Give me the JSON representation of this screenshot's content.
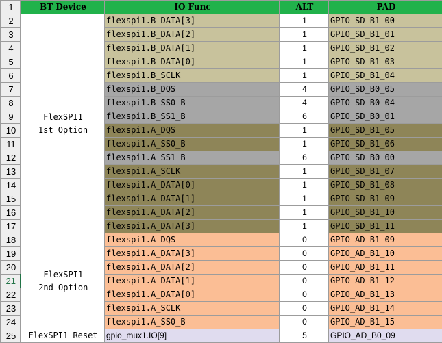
{
  "header": {
    "row": "1",
    "device": "BT Device",
    "func": "IO Func",
    "alt": "ALT",
    "pad": "PAD"
  },
  "groups": [
    {
      "label1": "FlexSPI1",
      "label2": "1st Option"
    },
    {
      "label1": "FlexSPI1",
      "label2": "2nd Option"
    },
    {
      "label1": "FlexSPI1 Reset",
      "label2": ""
    }
  ],
  "rows": [
    {
      "n": "2",
      "func": "flexspi1.B_DATA[3]",
      "alt": "1",
      "pad": "GPIO_SD_B1_00",
      "color": "tan"
    },
    {
      "n": "3",
      "func": "flexspi1.B_DATA[2]",
      "alt": "1",
      "pad": "GPIO_SD_B1_01",
      "color": "tan"
    },
    {
      "n": "4",
      "func": "flexspi1.B_DATA[1]",
      "alt": "1",
      "pad": "GPIO_SD_B1_02",
      "color": "tan"
    },
    {
      "n": "5",
      "func": "flexspi1.B_DATA[0]",
      "alt": "1",
      "pad": "GPIO_SD_B1_03",
      "color": "tan"
    },
    {
      "n": "6",
      "func": "flexspi1.B_SCLK",
      "alt": "1",
      "pad": "GPIO_SD_B1_04",
      "color": "tan"
    },
    {
      "n": "7",
      "func": "flexspi1.B_DQS",
      "alt": "4",
      "pad": "GPIO_SD_B0_05",
      "color": "gray"
    },
    {
      "n": "8",
      "func": "flexspi1.B_SS0_B",
      "alt": "4",
      "pad": "GPIO_SD_B0_04",
      "color": "gray"
    },
    {
      "n": "9",
      "func": "flexspi1.B_SS1_B",
      "alt": "6",
      "pad": "GPIO_SD_B0_01",
      "color": "gray"
    },
    {
      "n": "10",
      "func": "flexspi1.A_DQS",
      "alt": "1",
      "pad": "GPIO_SD_B1_05",
      "color": "olive"
    },
    {
      "n": "11",
      "func": "flexspi1.A_SS0_B",
      "alt": "1",
      "pad": "GPIO_SD_B1_06",
      "color": "olive"
    },
    {
      "n": "12",
      "func": "flexspi1.A_SS1_B",
      "alt": "6",
      "pad": "GPIO_SD_B0_00",
      "color": "gray"
    },
    {
      "n": "13",
      "func": "flexspi1.A_SCLK",
      "alt": "1",
      "pad": "GPIO_SD_B1_07",
      "color": "olive"
    },
    {
      "n": "14",
      "func": "flexspi1.A_DATA[0]",
      "alt": "1",
      "pad": "GPIO_SD_B1_08",
      "color": "olive"
    },
    {
      "n": "15",
      "func": "flexspi1.A_DATA[1]",
      "alt": "1",
      "pad": "GPIO_SD_B1_09",
      "color": "olive"
    },
    {
      "n": "16",
      "func": "flexspi1.A_DATA[2]",
      "alt": "1",
      "pad": "GPIO_SD_B1_10",
      "color": "olive"
    },
    {
      "n": "17",
      "func": "flexspi1.A_DATA[3]",
      "alt": "1",
      "pad": "GPIO_SD_B1_11",
      "color": "olive"
    },
    {
      "n": "18",
      "func": "flexspi1.A_DQS",
      "alt": "0",
      "pad": "GPIO_AD_B1_09",
      "color": "peach"
    },
    {
      "n": "19",
      "func": "flexspi1.A_DATA[3]",
      "alt": "0",
      "pad": "GPIO_AD_B1_10",
      "color": "peach"
    },
    {
      "n": "20",
      "func": "flexspi1.A_DATA[2]",
      "alt": "0",
      "pad": "GPIO_AD_B1_11",
      "color": "peach"
    },
    {
      "n": "21",
      "func": "flexspi1.A_DATA[1]",
      "alt": "0",
      "pad": "GPIO_AD_B1_12",
      "color": "peach"
    },
    {
      "n": "22",
      "func": "flexspi1.A_DATA[0]",
      "alt": "0",
      "pad": "GPIO_AD_B1_13",
      "color": "peach"
    },
    {
      "n": "23",
      "func": "flexspi1.A_SCLK",
      "alt": "0",
      "pad": "GPIO_AD_B1_14",
      "color": "peach"
    },
    {
      "n": "24",
      "func": "flexspi1.A_SS0_B",
      "alt": "0",
      "pad": "GPIO_AD_B1_15",
      "color": "peach"
    },
    {
      "n": "25",
      "func": "gpio_mux1.IO[9]",
      "alt": "5",
      "pad": "GPIO_AD_B0_09",
      "color": "lav"
    }
  ],
  "colors": {
    "header_green": "#21b24b",
    "tan": "#c8c29c",
    "gray": "#a6a6a6",
    "olive": "#8e8558",
    "peach": "#fbbe95",
    "lavender": "#e0dcef"
  }
}
